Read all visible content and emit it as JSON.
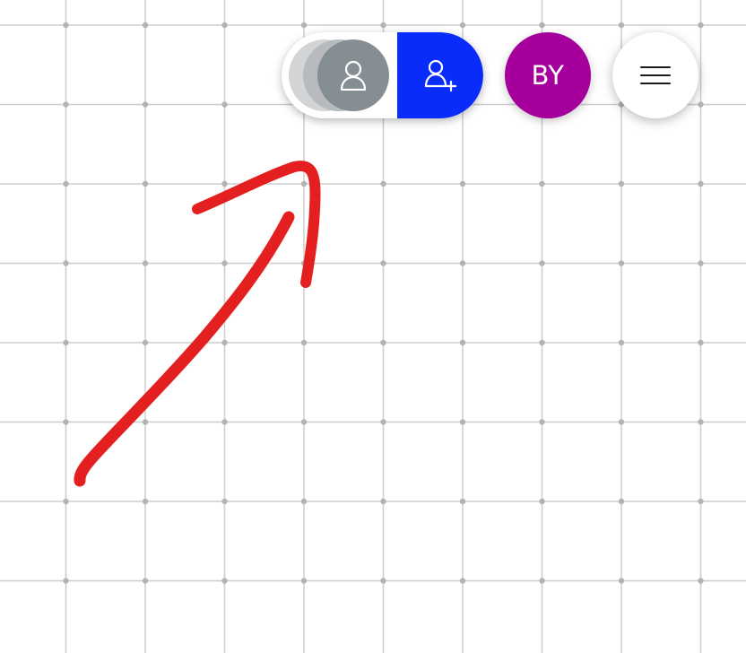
{
  "canvas": {
    "background": "#ffffff",
    "grid_color": "#cdcdcd",
    "grid_dot_color": "#b3b3b3"
  },
  "annotation": {
    "type": "hand-drawn-arrow",
    "color": "#e41f1f",
    "icon": "arrow-annotation"
  },
  "toolbar": {
    "collaborators": {
      "icon": "user-icon",
      "ghost_colors": [
        "#d2d4d5",
        "#b7bbbd"
      ],
      "avatar_color": "#858e93"
    },
    "invite": {
      "icon": "add-user-icon",
      "color": "#0a2cfb"
    },
    "current_user": {
      "initials": "BY",
      "color": "#a5009b"
    },
    "menu": {
      "icon": "hamburger-menu-icon"
    }
  }
}
